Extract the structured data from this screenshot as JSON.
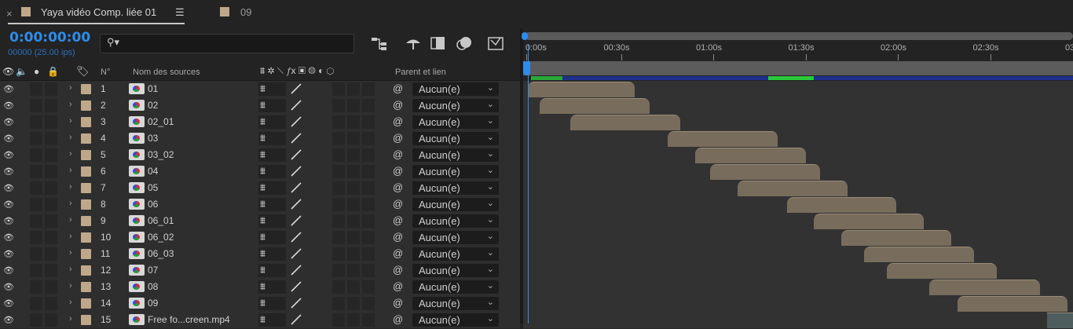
{
  "tabs": [
    {
      "label": "Yaya vidéo Comp. liée 01",
      "menu": "☰",
      "close": "×"
    },
    {
      "label": "09"
    }
  ],
  "timecode": "0:00:00:00",
  "frames_info": "00000 (25.00 ips)",
  "search": {
    "placeholder": ""
  },
  "columns": {
    "number": "N°",
    "source_name": "Nom des sources",
    "parent": "Parent et lien"
  },
  "ruler_ticks": [
    "0:00s",
    "00:30s",
    "01:00s",
    "01:30s",
    "02:00s",
    "02:30s",
    "03"
  ],
  "layers": [
    {
      "num": "1",
      "name": "01",
      "parent": "Aucun(e)",
      "start": 0.0,
      "end": 0.196
    },
    {
      "num": "2",
      "name": "02",
      "parent": "Aucun(e)",
      "start": 0.022,
      "end": 0.223
    },
    {
      "num": "3",
      "name": "02_01",
      "parent": "Aucun(e)",
      "start": 0.078,
      "end": 0.28
    },
    {
      "num": "4",
      "name": "03",
      "parent": "Aucun(e)",
      "start": 0.257,
      "end": 0.458
    },
    {
      "num": "5",
      "name": "03_02",
      "parent": "Aucun(e)",
      "start": 0.307,
      "end": 0.51
    },
    {
      "num": "6",
      "name": "04",
      "parent": "Aucun(e)",
      "start": 0.335,
      "end": 0.536
    },
    {
      "num": "7",
      "name": "05",
      "parent": "Aucun(e)",
      "start": 0.385,
      "end": 0.587
    },
    {
      "num": "8",
      "name": "06",
      "parent": "Aucun(e)",
      "start": 0.475,
      "end": 0.676
    },
    {
      "num": "9",
      "name": "06_01",
      "parent": "Aucun(e)",
      "start": 0.525,
      "end": 0.726
    },
    {
      "num": "10",
      "name": "06_02",
      "parent": "Aucun(e)",
      "start": 0.575,
      "end": 0.776
    },
    {
      "num": "11",
      "name": "06_03",
      "parent": "Aucun(e)",
      "start": 0.616,
      "end": 0.818
    },
    {
      "num": "12",
      "name": "07",
      "parent": "Aucun(e)",
      "start": 0.659,
      "end": 0.86
    },
    {
      "num": "13",
      "name": "08",
      "parent": "Aucun(e)",
      "start": 0.737,
      "end": 0.939
    },
    {
      "num": "14",
      "name": "09",
      "parent": "Aucun(e)",
      "start": 0.788,
      "end": 0.99
    },
    {
      "num": "15",
      "name": "Free fo...creen.mp4",
      "parent": "Aucun(e)",
      "start": 0.952,
      "end": 1.0
    }
  ],
  "colors": {
    "accent": "#2d8ceb",
    "label": "#bfa88a",
    "bar": "#786c5c"
  }
}
